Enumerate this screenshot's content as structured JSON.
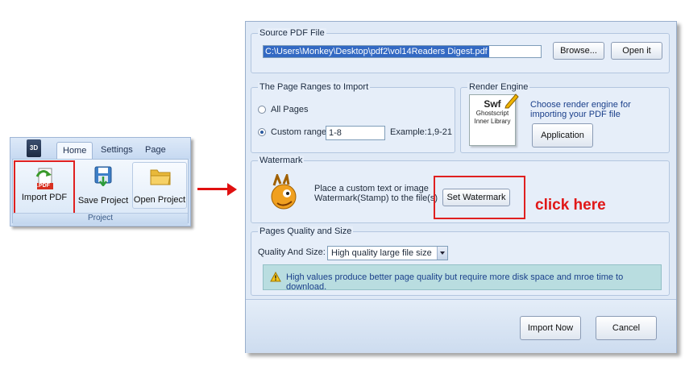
{
  "ribbon": {
    "app_icon_label": "3D",
    "tabs": [
      {
        "label": "Home",
        "active": true
      },
      {
        "label": "Settings",
        "active": false
      },
      {
        "label": "Page Layout",
        "active": false
      }
    ],
    "buttons": {
      "import_pdf": "Import PDF",
      "import_badge": ".PDF",
      "save_project": "Save Project",
      "open_project": "Open Project"
    },
    "group_label": "Project"
  },
  "dialog": {
    "source": {
      "legend": "Source PDF File",
      "path": "C:\\Users\\Monkey\\Desktop\\pdf2\\vol14Readers Digest.pdf",
      "browse": "Browse...",
      "open_it": "Open it"
    },
    "ranges": {
      "legend": "The Page Ranges to Import",
      "all_pages": "All Pages",
      "custom_range": "Custom range:",
      "custom_value": "1-8",
      "example": "Example:1,9-21",
      "selected": "custom"
    },
    "render": {
      "legend": "Render Engine",
      "swf_title": "Swf",
      "swf_line1": "Ghostscript",
      "swf_line2": "Inner Library",
      "description_line1": "Choose render engine for",
      "description_line2": "importing your PDF file",
      "button": "Application"
    },
    "watermark": {
      "legend": "Watermark",
      "text_line1": "Place a custom text or image",
      "text_line2": "Watermark(Stamp) to the file(s)",
      "button": "Set Watermark"
    },
    "quality": {
      "legend": "Pages Quality and Size",
      "label": "Quality And Size:",
      "selected": "High quality large file size",
      "info": "High values produce better page quality but require more disk space and mroe time to download."
    },
    "footer": {
      "import_now": "Import Now",
      "cancel": "Cancel"
    }
  },
  "annotation": {
    "click_here": "click here",
    "highlight_color": "#e01818"
  }
}
